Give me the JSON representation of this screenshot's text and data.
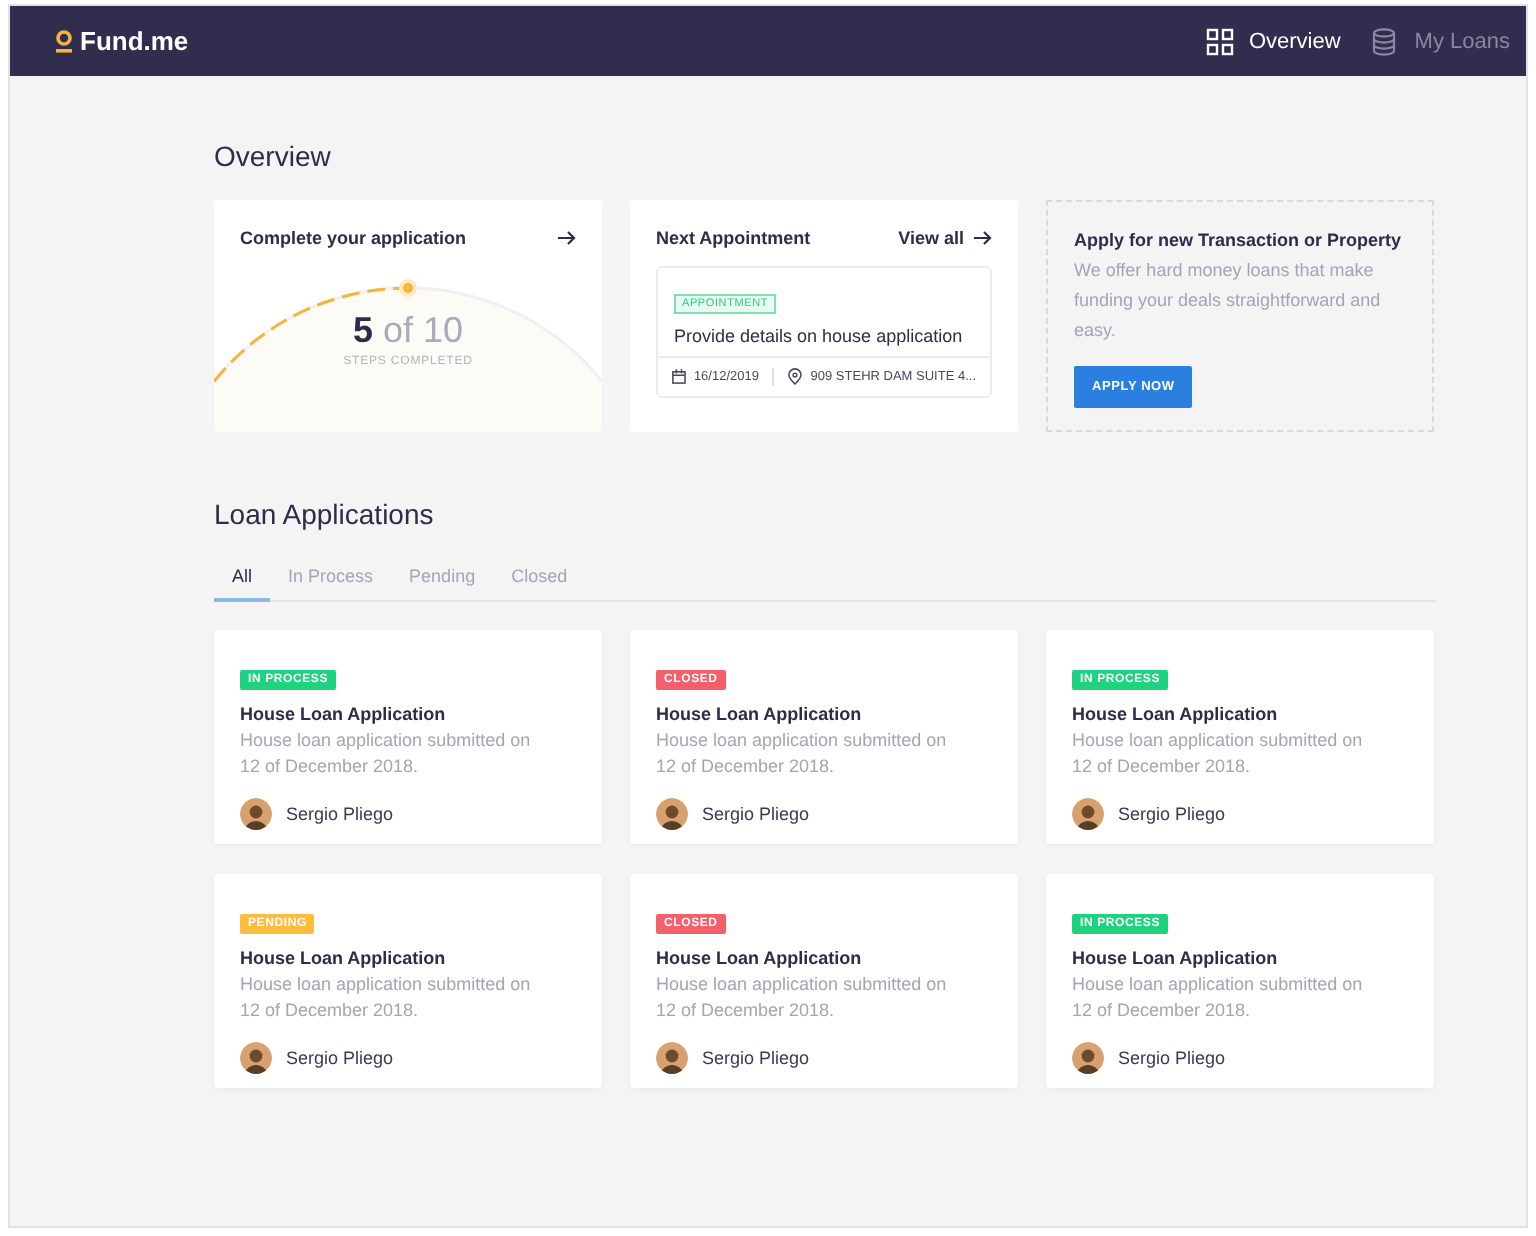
{
  "nav": {
    "logo": "Fund.me",
    "items": [
      {
        "label": "Overview",
        "selected": true,
        "kind": "grid"
      },
      {
        "label": "My Loans",
        "selected": false,
        "kind": "stack"
      }
    ]
  },
  "overview": {
    "title": "Overview",
    "progress": {
      "title": "Complete your application",
      "value": "5",
      "total": "of 10",
      "caption": "STEPS COMPLETED",
      "level": 0.5
    },
    "appointment": {
      "title": "Next Appointment",
      "link": "View all",
      "badge": "APPOINTMENT",
      "text": "Provide details on house application",
      "date": "16/12/2019",
      "location": "909 STEHR DAM SUITE 4..."
    },
    "apply": {
      "title": "Apply for new Transaction or Property",
      "text": "We offer hard money loans that make funding your deals straightforward and easy.",
      "button": "APPLY NOW"
    }
  },
  "loans": {
    "title": "Loan Applications",
    "tabs": [
      {
        "label": "All",
        "selected": true
      },
      {
        "label": "In Process",
        "selected": false
      },
      {
        "label": "Pending",
        "selected": false
      },
      {
        "label": "Closed",
        "selected": false
      }
    ],
    "cards": [
      {
        "status": "IN PROCESS",
        "color": "#1fd27f",
        "title": "House Loan Application",
        "text": "House loan application submitted on 12 of December 2018.",
        "person": "Sergio Pliego"
      },
      {
        "status": "CLOSED",
        "color": "#f4606a",
        "title": "House Loan Application",
        "text": "House loan application submitted on 12 of December 2018.",
        "person": "Sergio Pliego"
      },
      {
        "status": "IN PROCESS",
        "color": "#1fd27f",
        "title": "House Loan Application",
        "text": "House loan application submitted on 12 of December 2018.",
        "person": "Sergio Pliego"
      },
      {
        "status": "PENDING",
        "color": "#fcbd3c",
        "title": "House Loan Application",
        "text": "House loan application submitted on 12 of December 2018.",
        "person": "Sergio Pliego"
      },
      {
        "status": "CLOSED",
        "color": "#f4606a",
        "title": "House Loan Application",
        "text": "House loan application submitted on 12 of December 2018.",
        "person": "Sergio Pliego"
      },
      {
        "status": "IN PROCESS",
        "color": "#1fd27f",
        "title": "House Loan Application",
        "text": "House loan application submitted on 12 of December 2018.",
        "person": "Sergio Pliego"
      }
    ]
  }
}
